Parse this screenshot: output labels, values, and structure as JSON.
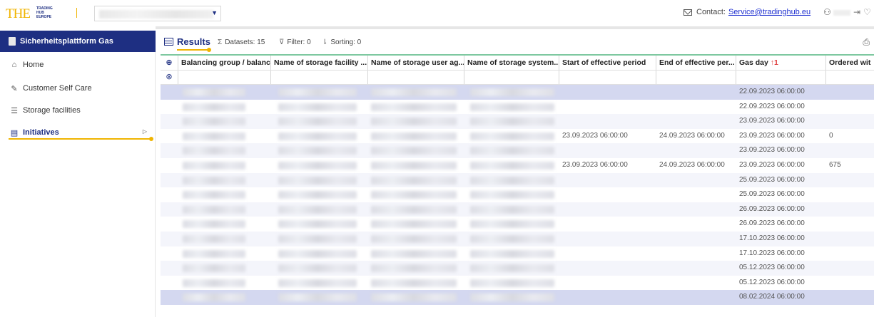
{
  "header": {
    "logo_line1": "TRADING",
    "logo_line2": "HUB",
    "logo_line3": "EUROPE",
    "contact_label": "Contact:",
    "contact_email": "Service@tradinghub.eu"
  },
  "sidebar": {
    "title": "Sicherheitsplattform Gas",
    "items": [
      {
        "label": "Home",
        "icon": "home-icon"
      },
      {
        "label": "Customer Self Care",
        "icon": "edit-icon"
      },
      {
        "label": "Storage facilities",
        "icon": "database-icon"
      },
      {
        "label": "Initiatives",
        "icon": "table-icon",
        "active": true
      }
    ]
  },
  "toolbar": {
    "title": "Results",
    "datasets": "Datasets: 15",
    "filter": "Filter: 0",
    "sorting": "Sorting: 0"
  },
  "table": {
    "columns": [
      "Balancing group / balanc...",
      "Name of storage facility ...",
      "Name of storage user ag...",
      "Name of storage system...",
      "Start of effective period",
      "End of effective per...",
      "Gas day",
      "Ordered wit"
    ],
    "sort_indicator": "↑1",
    "rows": [
      {
        "start": "",
        "end": "",
        "gasday": "22.09.2023 06:00:00",
        "ordered": ""
      },
      {
        "start": "",
        "end": "",
        "gasday": "22.09.2023 06:00:00",
        "ordered": ""
      },
      {
        "start": "",
        "end": "",
        "gasday": "23.09.2023 06:00:00",
        "ordered": ""
      },
      {
        "start": "23.09.2023 06:00:00",
        "end": "24.09.2023 06:00:00",
        "gasday": "23.09.2023 06:00:00",
        "ordered": "0"
      },
      {
        "start": "",
        "end": "",
        "gasday": "23.09.2023 06:00:00",
        "ordered": ""
      },
      {
        "start": "23.09.2023 06:00:00",
        "end": "24.09.2023 06:00:00",
        "gasday": "23.09.2023 06:00:00",
        "ordered": "675"
      },
      {
        "start": "",
        "end": "",
        "gasday": "25.09.2023 06:00:00",
        "ordered": ""
      },
      {
        "start": "",
        "end": "",
        "gasday": "25.09.2023 06:00:00",
        "ordered": ""
      },
      {
        "start": "",
        "end": "",
        "gasday": "26.09.2023 06:00:00",
        "ordered": ""
      },
      {
        "start": "",
        "end": "",
        "gasday": "26.09.2023 06:00:00",
        "ordered": ""
      },
      {
        "start": "",
        "end": "",
        "gasday": "17.10.2023 06:00:00",
        "ordered": ""
      },
      {
        "start": "",
        "end": "",
        "gasday": "17.10.2023 06:00:00",
        "ordered": ""
      },
      {
        "start": "",
        "end": "",
        "gasday": "05.12.2023 06:00:00",
        "ordered": ""
      },
      {
        "start": "",
        "end": "",
        "gasday": "05.12.2023 06:00:00",
        "ordered": ""
      },
      {
        "start": "",
        "end": "",
        "gasday": "08.02.2024 06:00:00",
        "ordered": ""
      }
    ]
  },
  "colors": {
    "brand_blue": "#1e2f82",
    "accent_yellow": "#f0b400",
    "selected_row": "#d4d8f0",
    "header_border": "#7ec8a0"
  }
}
